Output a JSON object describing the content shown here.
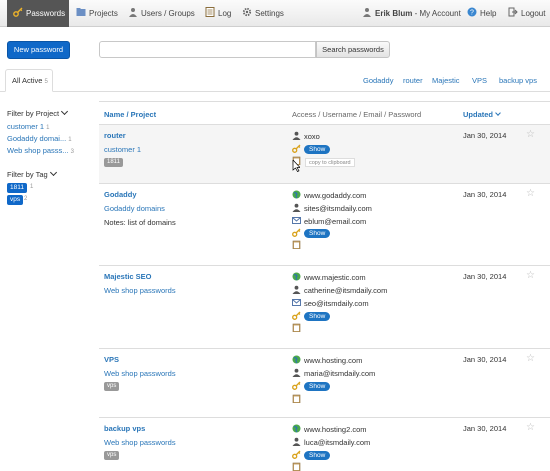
{
  "nav": {
    "items": [
      {
        "label": "Passwords",
        "icon": "key-icon",
        "active": true
      },
      {
        "label": "Projects",
        "icon": "folder-icon"
      },
      {
        "label": "Users / Groups",
        "icon": "users-icon"
      },
      {
        "label": "Log",
        "icon": "log-icon"
      },
      {
        "label": "Settings",
        "icon": "gear-icon"
      }
    ],
    "user_name": "Erik Blum",
    "user_suffix": " - My Account",
    "help": "Help",
    "logout": "Logout"
  },
  "toolbar": {
    "new_password": "New password",
    "search_placeholder": "",
    "search_button": "Search passwords"
  },
  "tabs": {
    "all_label": "All Active",
    "all_count": "5",
    "tag_tabs": [
      "Godaddy",
      "router",
      "Majestic",
      "VPS",
      "backup vps"
    ]
  },
  "sidebar": {
    "filter_project_label": "Filter by Project",
    "projects": [
      {
        "label": "customer 1",
        "count": "1"
      },
      {
        "label": "Godaddy domai...",
        "count": "1"
      },
      {
        "label": "Web shop passs...",
        "count": "3"
      }
    ],
    "filter_tag_label": "Filter by Tag",
    "tags": [
      {
        "label": "1811",
        "count": "1"
      },
      {
        "label": "vps",
        "count": "2"
      }
    ]
  },
  "table": {
    "col_name": "Name / Project",
    "col_access": "Access / Username / Email / Password",
    "col_updated": "Updated",
    "show_label": "Show",
    "copy_tip": "copy to clipboard",
    "rows": [
      {
        "name": "router",
        "project": "customer 1",
        "notes": "",
        "tag": "1811",
        "date": "Jan 30, 2014",
        "access": "",
        "username": "xoxo",
        "email": ""
      },
      {
        "name": "Godaddy",
        "project": "Godaddy domains",
        "notes": "Notes: list of domains",
        "tag": "",
        "date": "Jan 30, 2014",
        "access": "www.godaddy.com",
        "username": "sites@itsmdaily.com",
        "email": "eblum@email.com"
      },
      {
        "name": "Majestic SEO",
        "project": "Web shop passwords",
        "notes": "",
        "tag": "",
        "date": "Jan 30, 2014",
        "access": "www.majestic.com",
        "username": "catherine@itsmdaily.com",
        "email": "seo@itsmdaily.com"
      },
      {
        "name": "VPS",
        "project": "Web shop passwords",
        "notes": "",
        "tag": "vps",
        "date": "Jan 30, 2014",
        "access": "www.hosting.com",
        "username": "maria@itsmdaily.com",
        "email": ""
      },
      {
        "name": "backup vps",
        "project": "Web shop passwords",
        "notes": "",
        "tag": "vps",
        "date": "Jan 30, 2014",
        "access": "www.hosting2.com",
        "username": "luca@itsmdaily.com",
        "email": ""
      }
    ]
  },
  "colors": {
    "accent": "#0f68c8",
    "link": "#2a76b8",
    "nav_active": "#555555",
    "tag_grey": "#999999"
  }
}
